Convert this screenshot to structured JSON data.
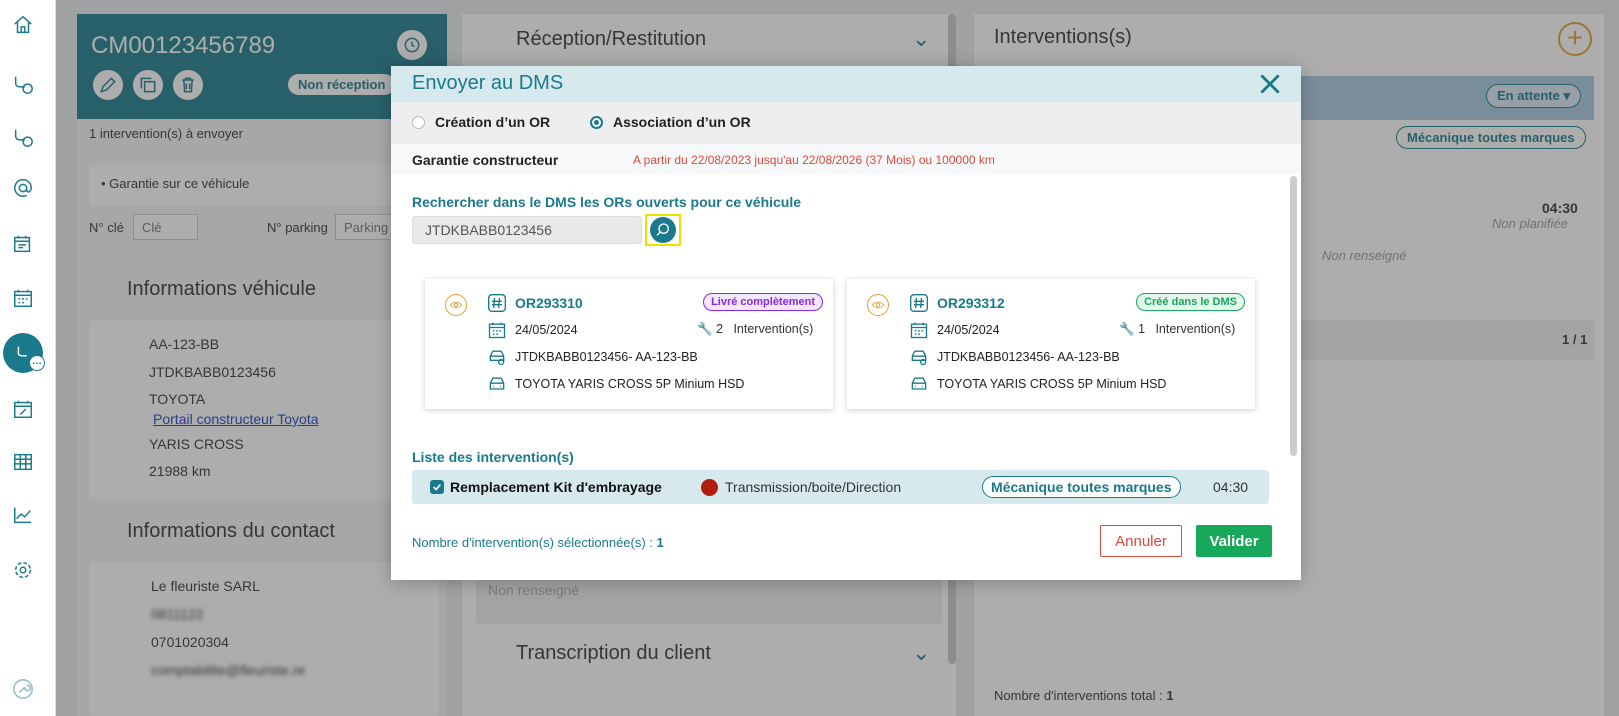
{
  "sidebar": {
    "icons": [
      "home-icon",
      "workflow-icon",
      "workflow-2-icon",
      "at-icon",
      "planning-icon",
      "calendar-icon",
      "workshop-active-icon",
      "calendar-percent-icon",
      "table-icon",
      "chart-icon",
      "settings-icon",
      "wrench-icon"
    ]
  },
  "left_panel": {
    "ref": "CM00123456789",
    "status_pill": "Non réception",
    "interventions_to_send": "1 intervention(s) à envoyer",
    "info_item": "Garantie sur ce véhicule",
    "key_label": "N° clé",
    "key_placeholder": "Clé",
    "parking_label": "N° parking",
    "parking_placeholder": "Parking",
    "vehicle_title": "Informations véhicule",
    "plate": "AA-123-BB",
    "vin": "JTDKBABB0123456",
    "brand": "TOYOTA",
    "portal_link": "Portail constructeur Toyota",
    "model": "YARIS CROSS",
    "mileage": "21988 km",
    "contact_title": "Informations du contact",
    "contact_name": "Le fleuriste SARL",
    "contact_id": "0811122",
    "phone": "0701020304",
    "email": "comptabilite@fleuriste.re"
  },
  "middle_panel": {
    "reception_title": "Réception/Restitution",
    "transcription_title": "Transcription du client",
    "placeholder_text": "Non renseigné"
  },
  "right_panel": {
    "title": "Interventions(s)",
    "status_dropdown": "En attente",
    "category_pill": "Mécanique toutes marques",
    "duration": "04:30",
    "planned_status": "Non planifiée",
    "not_filled": "Non renseigné",
    "pager": "1 / 1",
    "total_label": "Nombre d'interventions total :",
    "total_value": "1"
  },
  "modal": {
    "title": "Envoyer au DMS",
    "radio_create": "Création d’un OR",
    "radio_associate": "Association d’un OR",
    "selected_radio": "associate",
    "garantie_label": "Garantie constructeur",
    "garantie_text": "A partir du 22/08/2023 jusqu'au 22/08/2026 (37 Mois) ou 100000 km",
    "search_label": "Rechercher dans le DMS les ORs ouverts pour ce véhicule",
    "search_value": "JTDKBABB0123456",
    "or_cards": [
      {
        "number": "OR293310",
        "badge": "Livré complètement",
        "date": "24/05/2024",
        "interventions_count": "2",
        "interventions_label": "Intervention(s)",
        "vin_plate": "JTDKBABB0123456- AA-123-BB",
        "model": "TOYOTA YARIS CROSS 5P Minium HSD"
      },
      {
        "number": "OR293312",
        "badge": "Créé dans le DMS",
        "date": "24/05/2024",
        "interventions_count": "1",
        "interventions_label": "Intervention(s)",
        "vin_plate": "JTDKBABB0123456- AA-123-BB",
        "model": "TOYOTA YARIS CROSS 5P Minium HSD"
      }
    ],
    "list_title": "Liste des intervention(s)",
    "intervention": {
      "name": "Remplacement Kit d'embrayage",
      "category": "Transmission/boite/Direction",
      "category_color": "#b01e0e",
      "pill": "Mécanique toutes marques",
      "duration": "04:30"
    },
    "selected_label": "Nombre d'intervention(s) sélectionnée(s) :",
    "selected_count": "1",
    "cancel_label": "Annuler",
    "validate_label": "Valider"
  }
}
